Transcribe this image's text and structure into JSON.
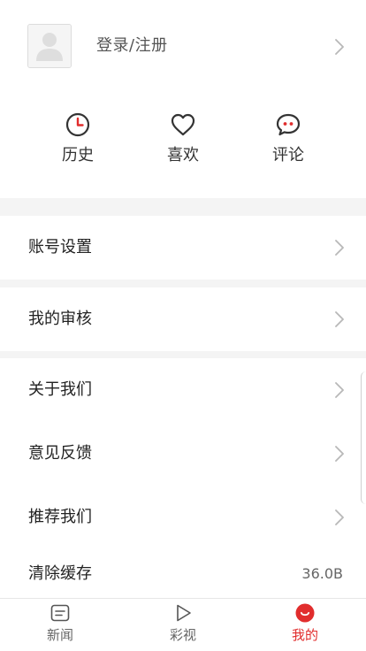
{
  "colors": {
    "accent": "#e12d2d",
    "text_primary": "#222222",
    "text_secondary": "#666666",
    "divider_bg": "#f4f4f4",
    "icon_dark": "#333333"
  },
  "header": {
    "avatar_icon": "default-avatar-icon",
    "login_label": "登录/注册"
  },
  "quick_actions": [
    {
      "label": "历史",
      "icon": "clock-icon"
    },
    {
      "label": "喜欢",
      "icon": "heart-icon"
    },
    {
      "label": "评论",
      "icon": "comment-icon"
    }
  ],
  "settings": {
    "account_settings": "账号设置",
    "my_review": "我的审核",
    "about_us": "关于我们",
    "feedback": "意见反馈",
    "recommend_us": "推荐我们",
    "clear_cache": "清除缓存",
    "cache_size": "36.0B"
  },
  "tabbar": {
    "tabs": [
      {
        "label": "新闻",
        "icon": "news-icon",
        "active": false
      },
      {
        "label": "彩视",
        "icon": "play-icon",
        "active": false
      },
      {
        "label": "我的",
        "icon": "profile-icon",
        "active": true
      }
    ]
  }
}
